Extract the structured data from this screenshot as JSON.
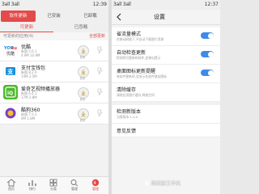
{
  "left": {
    "status": {
      "signal": "3all 3all",
      "time": "12:39"
    },
    "tabs": [
      "软件更新",
      "已安装",
      "已卸载"
    ],
    "subtabs": [
      "可更新",
      "已忽略"
    ],
    "listhead": {
      "left": "可更新的应用(4)",
      "right": "全部更新"
    },
    "apps": [
      {
        "name": "优酷",
        "meta1": "新版:5.6.1",
        "meta2": "4.9M 10.9M",
        "btn": "更新",
        "icon": "youku"
      },
      {
        "name": "支付宝钱包",
        "meta1": "新版:8.2.0",
        "meta2": "14M 2.5M",
        "btn": "更新",
        "icon": "alipay"
      },
      {
        "name": "爱奇艺视频播放器",
        "meta1": "新版:6.4.1",
        "meta2": "17M 2.8M",
        "btn": "更新",
        "icon": "iqiyi"
      },
      {
        "name": "酷狗360",
        "meta1": "新版:7.5.2",
        "meta2": "6M 1.8M",
        "btn": "更新",
        "icon": "kugou"
      }
    ],
    "nav": [
      "首页",
      "排行",
      "分类",
      "管理",
      "管理"
    ]
  },
  "right": {
    "status": {
      "signal": "3all 3all",
      "time": "12:37"
    },
    "title": "设置",
    "rows": [
      {
        "title": "省流量模式",
        "sub": "在移动网络下,不自动下载图片资源",
        "toggle": true
      },
      {
        "title": "自动检查更新",
        "sub": "检测到可更新的软件,会弹出提示",
        "toggle": true
      },
      {
        "title": "桌面图标更新提醒",
        "sub": "有软件更新时,会显示在软件商店图标",
        "toggle": true
      },
      {
        "title": "清除缓存",
        "sub": "清除应用图片缓存,释放空间",
        "toggle": false
      },
      {
        "title": "检测新版本",
        "sub": "当前版本:1.0.0",
        "toggle": false
      },
      {
        "title": "意见反馈",
        "sub": "",
        "toggle": false
      }
    ],
    "watermark": "网宗旗王手机"
  },
  "colors": {
    "accent": "#e44a4a",
    "toggle": "#3d8ae8"
  }
}
